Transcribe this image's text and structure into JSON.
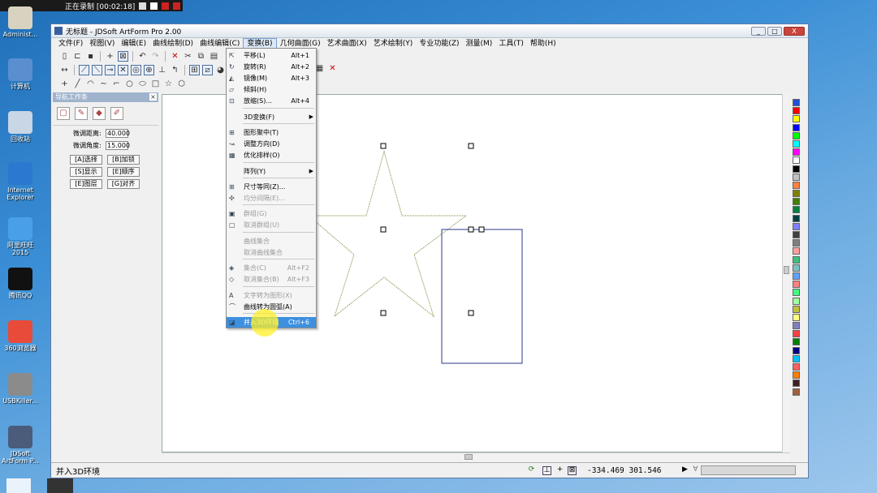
{
  "recorder": {
    "status": "正在录制 [00:02:18]"
  },
  "desktop_icons": [
    {
      "label": "Administ...",
      "color": "#d8d2c0"
    },
    {
      "label": "计算机",
      "color": "#5a8fcf"
    },
    {
      "label": "回收站",
      "color": "#c8d6e6"
    },
    {
      "label": "Internet Explorer",
      "color": "#2b78d0"
    },
    {
      "label": "阿里旺旺 2015",
      "color": "#4aa0e8"
    },
    {
      "label": "腾讯QQ",
      "color": "#111111"
    },
    {
      "label": "360浏览器",
      "color": "#e84b3a"
    },
    {
      "label": "USBKiller...",
      "color": "#8b8b8b"
    },
    {
      "label": "JDSoft ArtForm P...",
      "color": "#4a5c7a"
    }
  ],
  "window": {
    "title": "无标题 - JDSoft ArtForm Pro 2.00",
    "buttons": {
      "min": "_",
      "max": "□",
      "close": "X"
    }
  },
  "menubar": {
    "items": [
      "文件(F)",
      "视图(V)",
      "编辑(E)",
      "曲线绘制(D)",
      "曲线编辑(C)",
      "变换(B)",
      "几何曲面(G)",
      "艺术曲面(X)",
      "艺术绘制(Y)",
      "专业功能(Z)",
      "测量(M)",
      "工具(T)",
      "帮助(H)"
    ],
    "active_index": 5
  },
  "navpanel": {
    "title": "导航工作条",
    "fine_distance_label": "微调距离:",
    "fine_distance_value": "40.000",
    "fine_angle_label": "微调角度:",
    "fine_angle_value": "15.000",
    "buttons": [
      "[A]选择",
      "[B]加锁",
      "[S]显示",
      "[E]顺序",
      "[E]图层",
      "[G]对齐"
    ]
  },
  "dropdown": {
    "items": [
      {
        "label": "平移(L)",
        "shortcut": "Alt+1",
        "icon": "move-icon",
        "glyph": "⇱"
      },
      {
        "label": "旋转(R)",
        "shortcut": "Alt+2",
        "icon": "rotate-icon",
        "glyph": "↻"
      },
      {
        "label": "镜像(M)",
        "shortcut": "Alt+3",
        "icon": "mirror-icon",
        "glyph": "◭"
      },
      {
        "label": "倾斜(H)",
        "shortcut": "",
        "icon": "skew-icon",
        "glyph": "▱"
      },
      {
        "label": "放缩(S)...",
        "shortcut": "Alt+4",
        "icon": "scale-icon",
        "glyph": "⊡"
      },
      {
        "label": "3D变换(F)",
        "shortcut": "",
        "submenu": true
      },
      {
        "label": "图形聚中(T)",
        "shortcut": "",
        "icon": "center-icon",
        "glyph": "⊞"
      },
      {
        "label": "调整方向(D)",
        "shortcut": "",
        "icon": "direction-icon",
        "glyph": "↝"
      },
      {
        "label": "优化排样(O)",
        "shortcut": "",
        "icon": "nesting-icon",
        "glyph": "▦"
      },
      {
        "label": "阵列(Y)",
        "shortcut": "",
        "submenu": true
      },
      {
        "label": "尺寸等同(Z)...",
        "shortcut": "",
        "icon": "same-size-icon",
        "glyph": "⊞"
      },
      {
        "label": "均分间隔(E)...",
        "shortcut": "",
        "icon": "distribute-icon",
        "glyph": "✣",
        "disabled": true
      },
      {
        "label": "群组(G)",
        "shortcut": "",
        "icon": "group-icon",
        "glyph": "▣",
        "disabled": true
      },
      {
        "label": "取消群组(U)",
        "shortcut": "",
        "icon": "ungroup-icon",
        "glyph": "▢",
        "disabled": true
      },
      {
        "label": "曲线集合",
        "shortcut": "",
        "disabled": true
      },
      {
        "label": "取消曲线集合",
        "shortcut": "",
        "disabled": true
      },
      {
        "label": "集合(C)",
        "shortcut": "Alt+F2",
        "icon": "combine-icon",
        "glyph": "◈",
        "disabled": true
      },
      {
        "label": "取消集合(B)",
        "shortcut": "Alt+F3",
        "icon": "uncombine-icon",
        "glyph": "◇",
        "disabled": true
      },
      {
        "label": "文字转为图形(X)",
        "shortcut": "",
        "icon": "text-to-shape-icon",
        "glyph": "A",
        "disabled": true
      },
      {
        "label": "曲线转为圆弧(A)",
        "shortcut": "",
        "icon": "curve-to-arc-icon",
        "glyph": "⌒"
      },
      {
        "label": "并入3D环境",
        "shortcut": "Ctrl+6",
        "icon": "merge-3d-icon",
        "glyph": "◪",
        "highlighted": true
      }
    ]
  },
  "statusbar": {
    "message": "并入3D环境",
    "coords": "-334.469  301.546"
  },
  "palette": [
    "#1f4fd8",
    "#ff0000",
    "#ffff00",
    "#0000ff",
    "#00ff00",
    "#00ffff",
    "#ff00ff",
    "#ffffff",
    "#000000",
    "#c0c0c0",
    "#ff8040",
    "#808000",
    "#408000",
    "#008040",
    "#004040",
    "#8080ff",
    "#404040",
    "#808080",
    "#ffa0a0",
    "#40c080",
    "#80c0c0",
    "#60a0ff",
    "#ff8080",
    "#40ff80",
    "#a0ffa0",
    "#c0c040",
    "#ffff80",
    "#8080c0",
    "#ff4040",
    "#008000",
    "#000080",
    "#00c0ff",
    "#ff6060",
    "#ff8000",
    "#402020",
    "#a06040"
  ]
}
